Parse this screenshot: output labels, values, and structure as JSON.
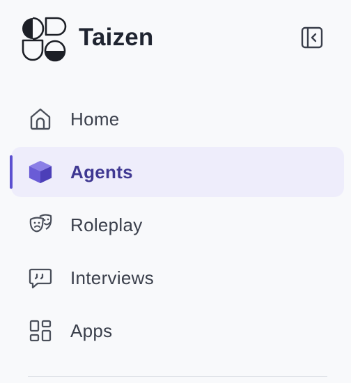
{
  "app": {
    "title": "Taizen"
  },
  "nav": {
    "items": [
      {
        "label": "Home",
        "icon": "home-icon",
        "active": false
      },
      {
        "label": "Agents",
        "icon": "cube-icon",
        "active": true
      },
      {
        "label": "Roleplay",
        "icon": "theater-masks-icon",
        "active": false
      },
      {
        "label": "Interviews",
        "icon": "chat-quote-icon",
        "active": false
      },
      {
        "label": "Apps",
        "icon": "apps-grid-icon",
        "active": false
      }
    ]
  },
  "colors": {
    "accent": "#5b4fd0",
    "active_bg": "#eeedfb",
    "active_text": "#3f3892",
    "text": "#3a3f4b",
    "icon": "#4a4f5a"
  }
}
